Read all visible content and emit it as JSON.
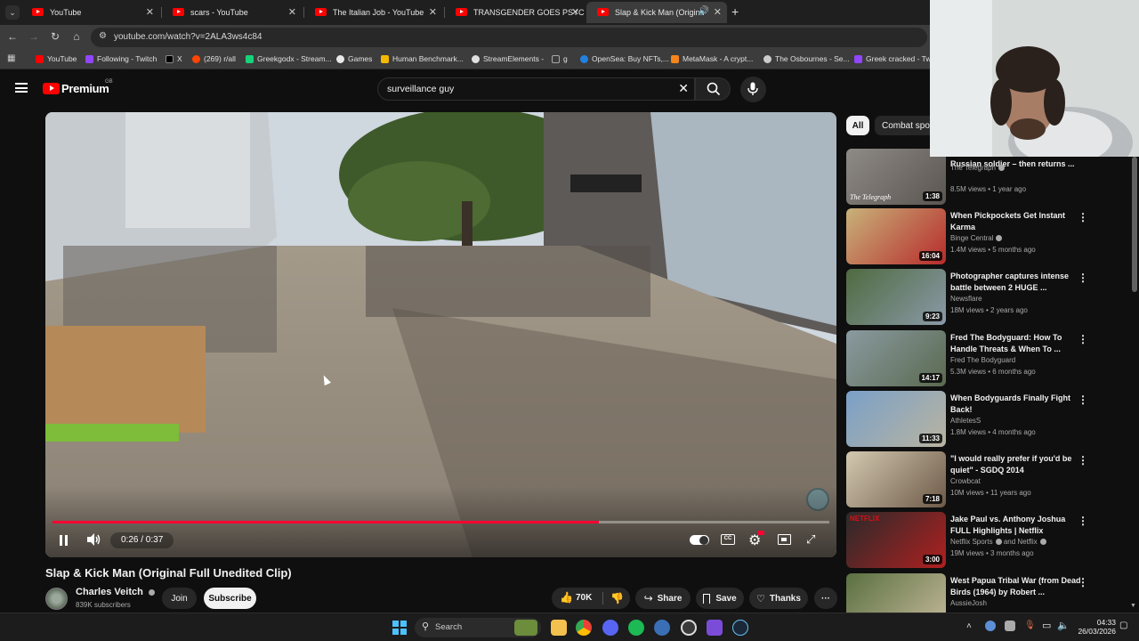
{
  "browser": {
    "tabs": [
      {
        "label": "YouTube",
        "active": false
      },
      {
        "label": "scars - YouTube",
        "active": false
      },
      {
        "label": "The Italian Job - YouTube",
        "active": false
      },
      {
        "label": "TRANSGENDER GOES PSYCHO",
        "active": false
      },
      {
        "label": "Slap & Kick Man (Original F",
        "active": true
      }
    ],
    "url": "youtube.com/watch?v=2ALA3ws4c84",
    "bookmarks": [
      {
        "label": "YouTube",
        "color": "#ff0000"
      },
      {
        "label": "Following - Twitch",
        "color": "#9146ff"
      },
      {
        "label": "X",
        "color": "#000000"
      },
      {
        "label": "(269) r/all",
        "color": "#ff4500"
      },
      {
        "label": "Greekgodx - Stream...",
        "color": "#18d27a"
      },
      {
        "label": "Games",
        "color": "#e8e8e8"
      },
      {
        "label": "Human Benchmark...",
        "color": "#f5b800"
      },
      {
        "label": "StreamElements -",
        "color": "#e0e0e0"
      },
      {
        "label": "g",
        "color": "#a0a0a0"
      },
      {
        "label": "OpenSea: Buy NFTs,...",
        "color": "#2081e2"
      },
      {
        "label": "MetaMask - A crypt...",
        "color": "#f6851b"
      },
      {
        "label": "The Osbournes - Se...",
        "color": "#cccccc"
      },
      {
        "label": "Greek cracked - Twi...",
        "color": "#9146ff"
      }
    ]
  },
  "youtube": {
    "logo_text": "Premium",
    "region": "GB",
    "search_value": "surveillance guy",
    "accent": "#ff0033"
  },
  "video": {
    "title": "Slap & Kick Man (Original Full Unedited Clip)",
    "current_time": "0:26",
    "duration": "0:37",
    "time_display": "0:26 / 0:37",
    "progress_fraction": 0.703,
    "buffered_fraction": 0.703
  },
  "channel": {
    "name": "Charles Veitch",
    "subscribers": "839K subscribers",
    "join_label": "Join",
    "subscribe_label": "Subscribe"
  },
  "actions": {
    "likes": "70K",
    "share_label": "Share",
    "save_label": "Save",
    "thanks_label": "Thanks"
  },
  "sidebar": {
    "chips": [
      {
        "label": "All",
        "selected": true
      },
      {
        "label": "Combat spor",
        "selected": false
      }
    ],
    "recommendations": [
      {
        "title": "Russian soldier – then returns ...",
        "channel": "The Telegraph",
        "verified": true,
        "meta": "8.5M views • 1 year ago",
        "duration": "1:38",
        "thumb_caption": "The Telegraph"
      },
      {
        "title": "When Pickpockets Get Instant Karma",
        "channel": "Binge Central",
        "verified": true,
        "meta": "1.4M views • 5 months ago",
        "duration": "16:04"
      },
      {
        "title": "Photographer captures intense battle between 2 HUGE ...",
        "channel": "Newsflare",
        "verified": false,
        "meta": "18M views • 2 years ago",
        "duration": "9:23"
      },
      {
        "title": "Fred The Bodyguard: How To Handle Threats & When To ...",
        "channel": "Fred The Bodyguard",
        "verified": false,
        "meta": "5.3M views • 6 months ago",
        "duration": "14:17"
      },
      {
        "title": "When Bodyguards Finally Fight Back!",
        "channel": "AthletesS",
        "verified": false,
        "meta": "1.8M views • 4 months ago",
        "duration": "11:33"
      },
      {
        "title": "\"I would really prefer if you'd be quiet\" - SGDQ 2014",
        "channel": "Crowbcat",
        "verified": false,
        "meta": "10M views • 11 years ago",
        "duration": "7:18"
      },
      {
        "title": "Jake Paul vs. Anthony Joshua FULL Highlights | Netflix",
        "channel": "Netflix Sports",
        "channel_extra": "and Netflix",
        "verified": true,
        "meta": "19M views • 3 months ago",
        "duration": "3:00",
        "thumb_caption": "NETFLIX"
      },
      {
        "title": "West Papua Tribal War (from Dead Birds (1964) by Robert ...",
        "channel": "AussieJosh",
        "verified": false,
        "meta": "",
        "duration": ""
      }
    ]
  },
  "taskbar": {
    "search_placeholder": "Search",
    "time": "04:33",
    "date": "26/03/2026"
  }
}
